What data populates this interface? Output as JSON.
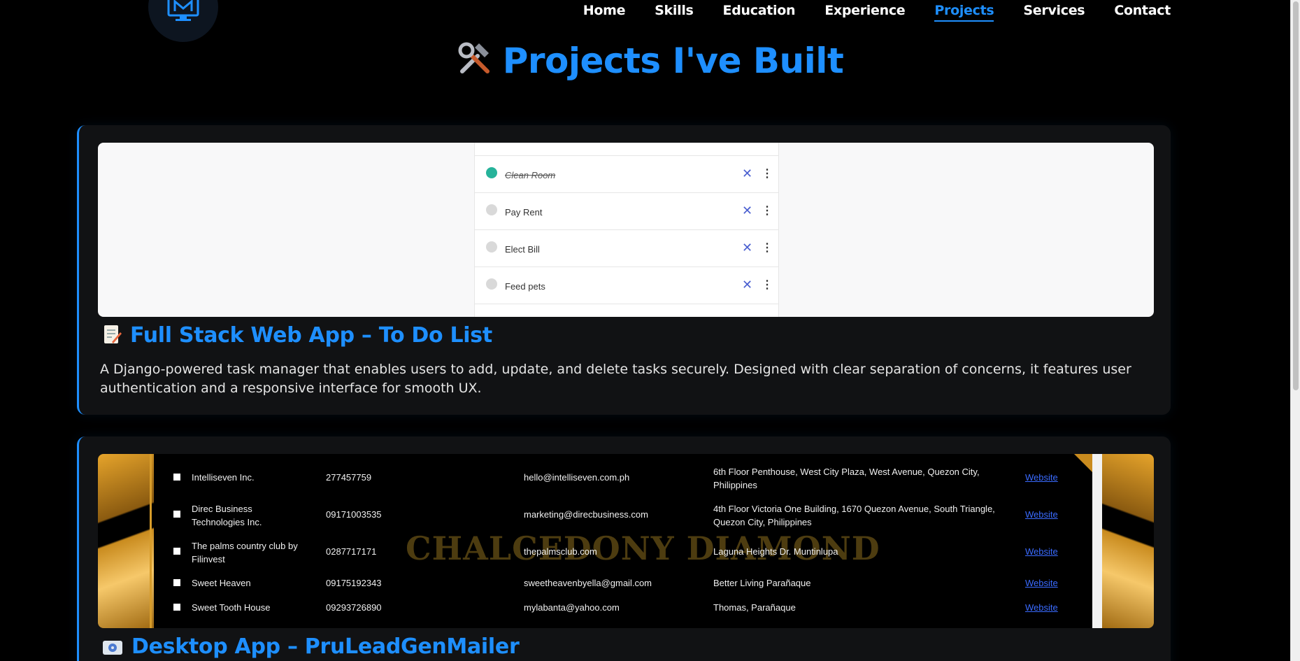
{
  "nav": {
    "items": [
      {
        "label": "Home"
      },
      {
        "label": "Skills"
      },
      {
        "label": "Education"
      },
      {
        "label": "Experience"
      },
      {
        "label": "Projects",
        "active": true
      },
      {
        "label": "Services"
      },
      {
        "label": "Contact"
      }
    ],
    "logo_icon": "monitor-m-logo-icon"
  },
  "page": {
    "title": "Projects I've Built",
    "title_icon": "hammer-wrench-icon",
    "accent_color": "#1e8fff"
  },
  "projects": [
    {
      "title": "Full Stack Web App – To Do List",
      "icon": "memo-icon",
      "description": "A Django-powered task manager that enables users to add, update, and delete tasks securely. Designed with clear separation of concerns, it features user authentication and a responsive interface for smooth UX.",
      "screenshot": {
        "tasks": [
          {
            "text": "Clean Room",
            "done": true
          },
          {
            "text": "Pay Rent",
            "done": false
          },
          {
            "text": "Elect Bill",
            "done": false
          },
          {
            "text": "Feed pets",
            "done": false
          }
        ]
      }
    },
    {
      "title": "Desktop App – PruLeadGenMailer",
      "icon": "disk-icon",
      "screenshot": {
        "watermark": "CHALCEDONY DIAMOND",
        "rows": [
          {
            "name": "Intelliseven Inc.",
            "phone": "277457759",
            "email": "hello@intelliseven.com.ph",
            "address": "6th Floor Penthouse, West City Plaza, West Avenue, Quezon City, Philippines",
            "link": "Website"
          },
          {
            "name": "Direc Business Technologies Inc.",
            "phone": "09171003535",
            "email": "marketing@direcbusiness.com",
            "address": "4th Floor Victoria One Building, 1670 Quezon Avenue, South Triangle, Quezon City, Philippines",
            "link": "Website"
          },
          {
            "name": "The palms country club by Filinvest",
            "phone": "0287717171",
            "email": "thepalmsclub.com",
            "address": "Laguna Heights Dr. Muntinlupa",
            "link": "Website"
          },
          {
            "name": "Sweet Heaven",
            "phone": "09175192343",
            "email": "sweetheavenbyella@gmail.com",
            "address": "Better Living Parañaque",
            "link": "Website"
          },
          {
            "name": "Sweet Tooth House",
            "phone": "09293726890",
            "email": "mylabanta@yahoo.com",
            "address": "Thomas, Parañaque",
            "link": "Website"
          }
        ]
      }
    }
  ]
}
